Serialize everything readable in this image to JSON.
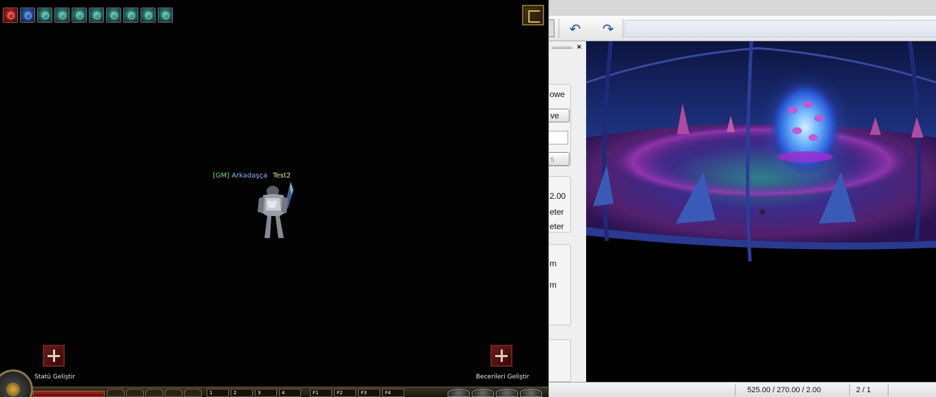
{
  "game": {
    "buffs": [
      {
        "icon": "red-potion-icon"
      },
      {
        "icon": "blue-potion-icon"
      },
      {
        "icon": "magic-shield-icon"
      },
      {
        "icon": "orb-icon"
      },
      {
        "icon": "scroll-icon"
      },
      {
        "icon": "claw-icon"
      },
      {
        "icon": "spiral-icon"
      },
      {
        "icon": "wing-icon"
      },
      {
        "icon": "hand-icon"
      },
      {
        "icon": "burst-icon"
      }
    ],
    "player": {
      "gm_tag": "[GM]",
      "guild": "Arkadaşça",
      "name": "Test2"
    },
    "stat_button_label": "Statü Geliştir",
    "skill_button_label": "Becerileri Geliştir",
    "fkeys": [
      "F1",
      "F2",
      "F3",
      "F4"
    ],
    "slot_numbers": [
      "1",
      "2",
      "3",
      "4"
    ]
  },
  "editor": {
    "toolbar": {
      "undo_icon": "undo-icon",
      "redo_icon": "redo-icon"
    },
    "side_panel": {
      "close_label": "×",
      "text_power": "owe",
      "button_ve": "ve",
      "button_s": "s",
      "value_2": "2.00",
      "label_eter_1": "eter",
      "label_eter_2": "eter",
      "label_m_1": "m",
      "label_m_2": "m"
    },
    "status": {
      "coords": "525.00 / 270.00 / 2.00",
      "page": "2 / 1"
    },
    "colors": {
      "accent": "#1f4fa0"
    }
  }
}
